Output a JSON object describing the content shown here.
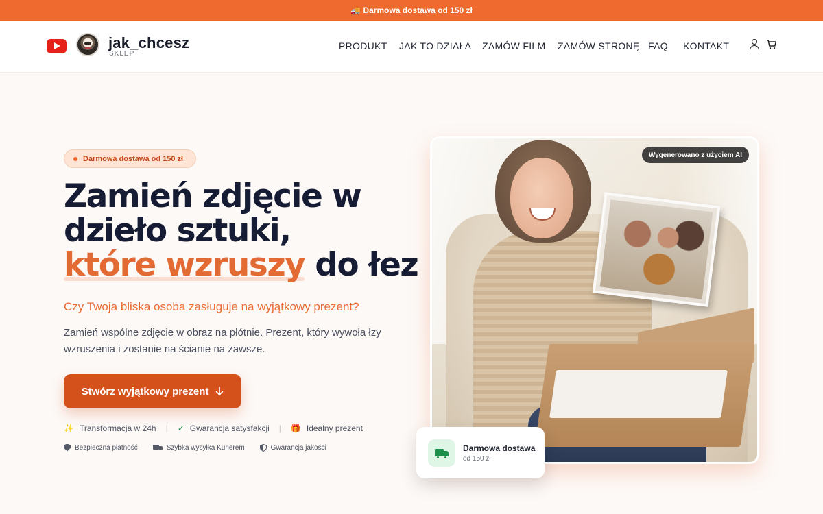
{
  "topbar": {
    "text": "🚚 Darmowa dostawa od 150 zł"
  },
  "header": {
    "brand_name": "jak_chcesz",
    "brand_sub": "SKLEP",
    "nav": [
      {
        "label": "PRODUKT"
      },
      {
        "label": "JAK TO DZIAŁA"
      },
      {
        "label": "ZAMÓW FILM"
      },
      {
        "label": "ZAMÓW STRONĘ"
      },
      {
        "label": "FAQ"
      },
      {
        "label": "KONTAKT"
      }
    ],
    "icons": [
      "user-icon",
      "cart-icon"
    ]
  },
  "hero": {
    "badge": "Darmowa dostawa od 150 zł",
    "headline_line1": "Zamień zdjęcie w",
    "headline_line2": "dzieło sztuki,",
    "headline_accent": "które wzruszy",
    "headline_end": "do łez",
    "question": "Czy Twoja bliska osoba zasługuje na wyjątkowy prezent?",
    "description": "Zamień wspólne zdjęcie w obraz na płótnie. Prezent, który wywoła łzy wzruszenia i zostanie na ścianie na zawsze.",
    "cta_label": "Stwórz wyjątkowy prezent",
    "features": [
      {
        "icon": "✨",
        "label": "Transformacja w 24h"
      },
      {
        "icon": "✓",
        "label": "Gwarancja satysfakcji"
      },
      {
        "icon": "🎁",
        "label": "Idealny prezent"
      }
    ],
    "trust": [
      {
        "icon": "shield-icon",
        "label": "Bezpieczna płatność"
      },
      {
        "icon": "truck-icon",
        "label": "Szybka wysyłka Kurierem"
      },
      {
        "icon": "shield-half-icon",
        "label": "Gwarancja jakości"
      }
    ],
    "image_badge": "Wygenerowano z użyciem AI",
    "delivery_card": {
      "title": "Darmowa dostawa",
      "subtitle": "od 150 zł"
    }
  },
  "colors": {
    "accent": "#ef6a2f",
    "cta": "#d4511c",
    "heading": "#161c33",
    "success": "#1e8f4a"
  }
}
